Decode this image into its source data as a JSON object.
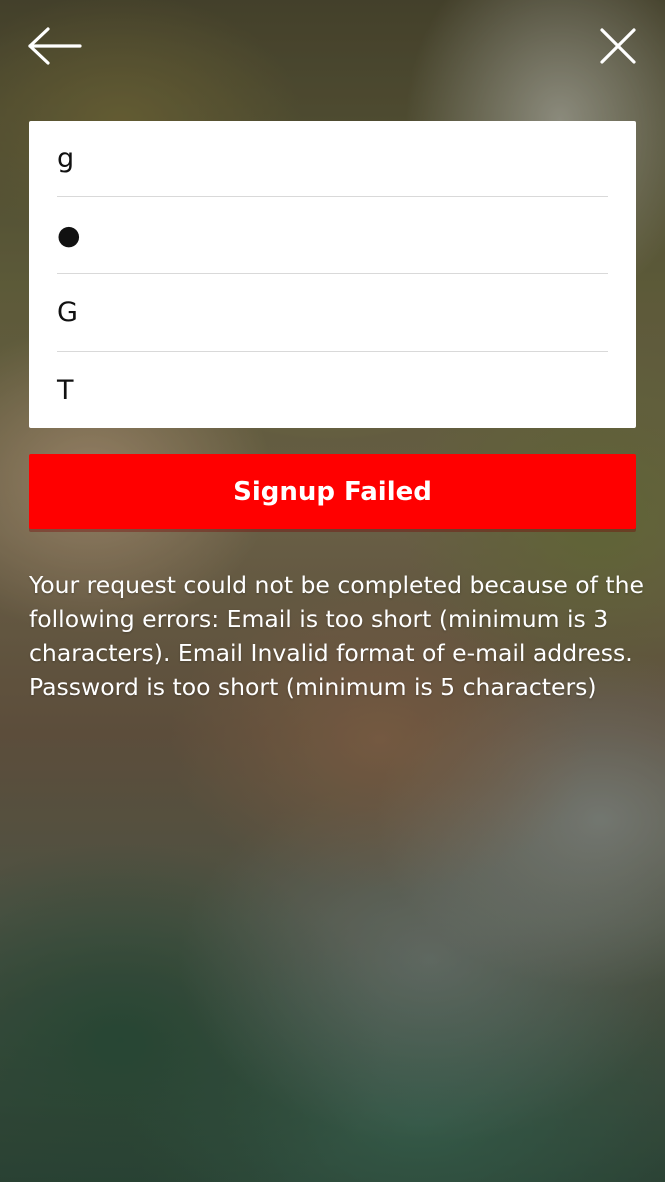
{
  "header": {
    "back_icon": "arrow-left-icon",
    "close_icon": "close-icon"
  },
  "form": {
    "fields": [
      {
        "value": "g"
      },
      {
        "value": "●"
      },
      {
        "value": "G"
      },
      {
        "value": "T"
      }
    ]
  },
  "signup_button": {
    "label": "Signup Failed",
    "color": "#ff0000"
  },
  "error_message": "Your request could not be completed because of the following errors: Email is too short (minimum is 3 characters). Email Invalid format of e-mail address. Password is too short (minimum is 5 characters)"
}
